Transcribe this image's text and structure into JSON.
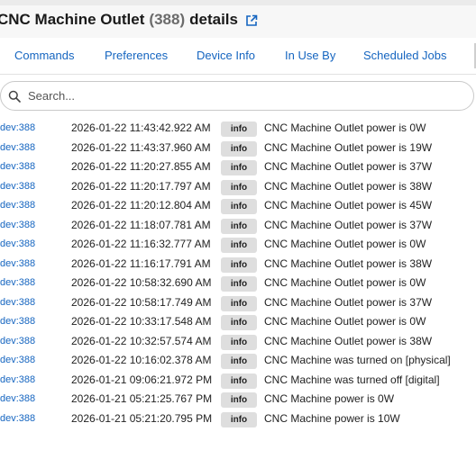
{
  "header": {
    "device_name": "CNC Machine Outlet",
    "device_id": "388",
    "suffix": "details",
    "open_icon": "external-link-icon"
  },
  "tabs": [
    "Commands",
    "Preferences",
    "Device Info",
    "In Use By",
    "Scheduled Jobs"
  ],
  "search": {
    "placeholder": "Search...",
    "value": "",
    "icon": "search-icon"
  },
  "colors": {
    "link": "#1565c0",
    "badge_bg": "#dedede",
    "text": "#222222"
  },
  "events": [
    {
      "dev": "dev:388",
      "time": "2026-01-22 11:43:42.922 AM",
      "level": "info",
      "message": "CNC Machine Outlet power is 0W"
    },
    {
      "dev": "dev:388",
      "time": "2026-01-22 11:43:37.960 AM",
      "level": "info",
      "message": "CNC Machine Outlet power is 19W"
    },
    {
      "dev": "dev:388",
      "time": "2026-01-22 11:20:27.855 AM",
      "level": "info",
      "message": "CNC Machine Outlet power is 37W"
    },
    {
      "dev": "dev:388",
      "time": "2026-01-22 11:20:17.797 AM",
      "level": "info",
      "message": "CNC Machine Outlet power is 38W"
    },
    {
      "dev": "dev:388",
      "time": "2026-01-22 11:20:12.804 AM",
      "level": "info",
      "message": "CNC Machine Outlet power is 45W"
    },
    {
      "dev": "dev:388",
      "time": "2026-01-22 11:18:07.781 AM",
      "level": "info",
      "message": "CNC Machine Outlet power is 37W"
    },
    {
      "dev": "dev:388",
      "time": "2026-01-22 11:16:32.777 AM",
      "level": "info",
      "message": "CNC Machine Outlet power is 0W"
    },
    {
      "dev": "dev:388",
      "time": "2026-01-22 11:16:17.791 AM",
      "level": "info",
      "message": "CNC Machine Outlet power is 38W"
    },
    {
      "dev": "dev:388",
      "time": "2026-01-22 10:58:32.690 AM",
      "level": "info",
      "message": "CNC Machine Outlet power is 0W"
    },
    {
      "dev": "dev:388",
      "time": "2026-01-22 10:58:17.749 AM",
      "level": "info",
      "message": "CNC Machine Outlet power is 37W"
    },
    {
      "dev": "dev:388",
      "time": "2026-01-22 10:33:17.548 AM",
      "level": "info",
      "message": "CNC Machine Outlet power is 0W"
    },
    {
      "dev": "dev:388",
      "time": "2026-01-22 10:32:57.574 AM",
      "level": "info",
      "message": "CNC Machine Outlet power is 38W"
    },
    {
      "dev": "dev:388",
      "time": "2026-01-22 10:16:02.378 AM",
      "level": "info",
      "message": "CNC Machine was turned on [physical]"
    },
    {
      "dev": "dev:388",
      "time": "2026-01-21 09:06:21.972 PM",
      "level": "info",
      "message": "CNC Machine was turned off [digital]"
    },
    {
      "dev": "dev:388",
      "time": "2026-01-21 05:21:25.767 PM",
      "level": "info",
      "message": "CNC Machine power is 0W"
    },
    {
      "dev": "dev:388",
      "time": "2026-01-21 05:21:20.795 PM",
      "level": "info",
      "message": "CNC Machine power is 10W"
    }
  ]
}
